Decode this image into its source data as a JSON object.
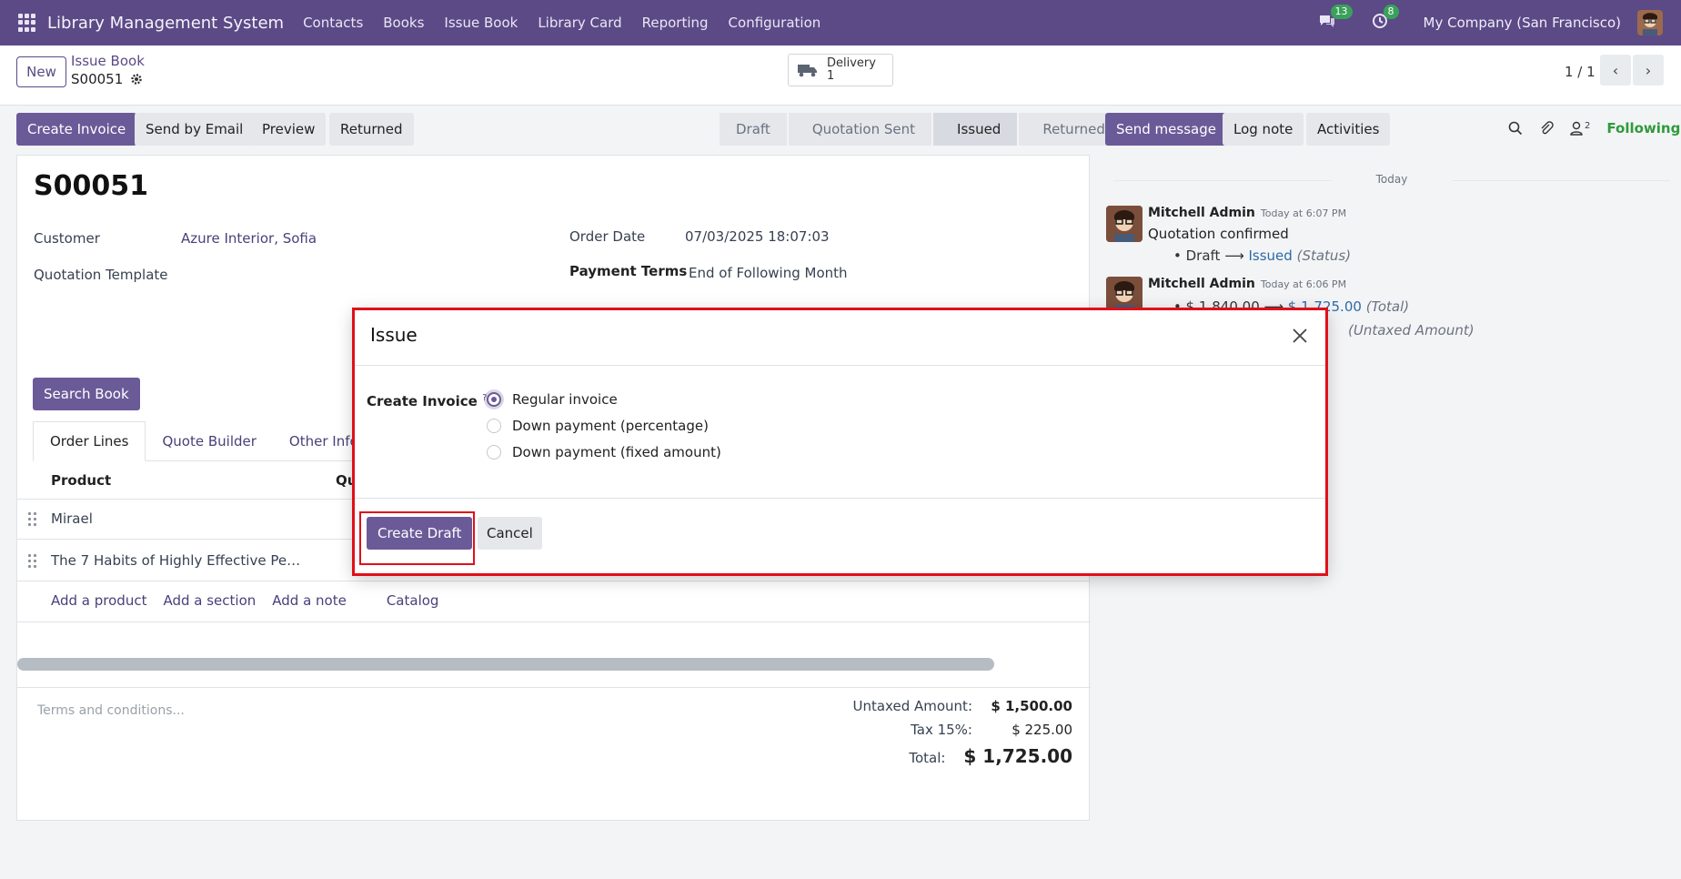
{
  "navbar": {
    "brand": "Library Management System",
    "menu": [
      "Contacts",
      "Books",
      "Issue Book",
      "Library Card",
      "Reporting",
      "Configuration"
    ],
    "messages_badge": "13",
    "activities_badge": "8",
    "company": "My Company (San Francisco)"
  },
  "control_panel": {
    "new_label": "New",
    "breadcrumb_parent": "Issue Book",
    "breadcrumb_current": "S00051",
    "delivery_label": "Delivery",
    "delivery_count": "1",
    "pager": "1 / 1"
  },
  "actions": {
    "create_invoice": "Create Invoice",
    "send_email": "Send by Email",
    "preview": "Preview",
    "returned": "Returned"
  },
  "statusbar": {
    "stages": [
      "Draft",
      "Quotation Sent",
      "Issued",
      "Returned"
    ],
    "active": "Issued"
  },
  "form": {
    "name": "S00051",
    "customer_label": "Customer",
    "customer_value": "Azure Interior, Sofia",
    "template_label": "Quotation Template",
    "order_date_label": "Order Date",
    "order_date_value": "07/03/2025 18:07:03",
    "payment_terms_label": "Payment Terms",
    "payment_terms_value": "End of Following Month",
    "search_book": "Search Book",
    "tabs": [
      "Order Lines",
      "Quote Builder",
      "Other Info"
    ],
    "col_product": "Product",
    "col_qty": "Qu",
    "lines": [
      "Mirael",
      "The 7 Habits of Highly Effective Pe…"
    ],
    "add_product": "Add a product",
    "add_section": "Add a section",
    "add_note": "Add a note",
    "catalog": "Catalog",
    "terms_placeholder": "Terms and conditions...",
    "untaxed_label": "Untaxed Amount:",
    "untaxed_value": "$ 1,500.00",
    "tax_label": "Tax 15%:",
    "tax_value": "$ 225.00",
    "total_label": "Total:",
    "total_value": "$ 1,725.00"
  },
  "chatter": {
    "send_message": "Send message",
    "log_note": "Log note",
    "activities": "Activities",
    "followers_count": "2",
    "following": "Following",
    "today": "Today",
    "msg1_author": "Mitchell Admin",
    "msg1_time": "Today at 6:07 PM",
    "msg1_body": "Quotation confirmed",
    "msg1_old": "Draft",
    "msg1_new": "Issued",
    "msg1_field": "(Status)",
    "msg2_author": "Mitchell Admin",
    "msg2_time": "Today at 6:06 PM",
    "msg2_old": "$ 1,840.00",
    "msg2_new": "$ 1,725.00",
    "msg2_field": "(Total)",
    "msg2_field2": "(Untaxed Amount)"
  },
  "dialog": {
    "title": "Issue",
    "field_label": "Create Invoice",
    "field_help": "?",
    "options": [
      "Regular invoice",
      "Down payment (percentage)",
      "Down payment (fixed amount)"
    ],
    "selected": "Regular invoice",
    "create_draft": "Create Draft",
    "cancel": "Cancel"
  },
  "colors": {
    "brand": "#5b4a86",
    "primary": "#6b5a98",
    "highlight": "#e0101a"
  }
}
